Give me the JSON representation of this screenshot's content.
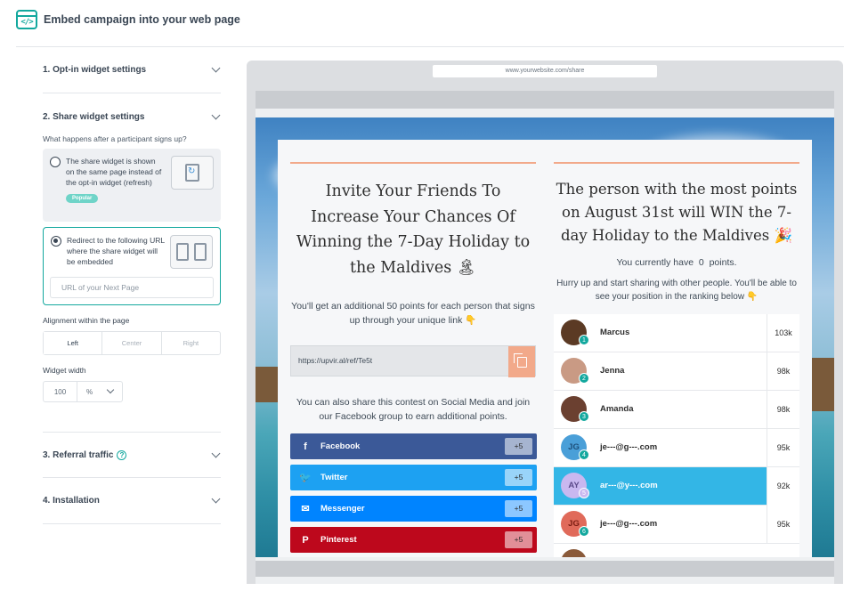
{
  "header": {
    "title": "Embed campaign into your web page",
    "icon": "embed-code-icon"
  },
  "left_panel": {
    "sections": [
      {
        "label": "1. Opt-in widget settings"
      },
      {
        "label": "2. Share widget settings"
      },
      {
        "label": "3. Referral traffic"
      },
      {
        "label": "4. Installation"
      }
    ],
    "question": "What happens after a participant signs up?",
    "option1": {
      "text": "The share widget is shown on the same page instead of the opt-in widget (refresh)",
      "badge": "Popular"
    },
    "option2": {
      "text": "Redirect to the following URL where the share widget will be embedded",
      "url_placeholder": "URL of your Next Page"
    },
    "alignment": {
      "label": "Alignment within the page",
      "options": [
        "Left",
        "Center",
        "Right"
      ],
      "selected": "Left"
    },
    "width": {
      "label": "Widget width",
      "value": "100",
      "unit": "%"
    }
  },
  "preview": {
    "address": "www.yourwebsite.com/share",
    "left": {
      "title": "Invite Your Friends To Increase Your Chances Of Winning the 7-Day Holiday to the Maldives 🏝",
      "desc": "You'll get an additional 50 points for each person that signs up through your unique link 👇",
      "link": "https://upvir.al/ref/Te5t",
      "social_desc": "You can also share this contest on Social Media and join our Facebook group to earn additional points.",
      "buttons": [
        {
          "label": "Facebook",
          "points": "+5",
          "color": "#3b5998",
          "icon": "f"
        },
        {
          "label": "Twitter",
          "points": "+5",
          "color": "#1da1f2",
          "icon": "🐦"
        },
        {
          "label": "Messenger",
          "points": "+5",
          "color": "#0084ff",
          "icon": "✉"
        },
        {
          "label": "Pinterest",
          "points": "+5",
          "color": "#bd081c",
          "icon": "P"
        }
      ]
    },
    "right": {
      "title": "The person with the most points on August 31st will WIN the 7-day Holiday to the Maldives 🎉",
      "points_pre": "You currently have",
      "points_val": "0",
      "points_post": "points.",
      "desc": "Hurry up and start sharing with other people. You'll be able to see your position in the ranking below 👇",
      "ranking": [
        {
          "pos": "1",
          "name": "Marcus",
          "score": "103k",
          "avatar": "photo",
          "color": "#5b3a24"
        },
        {
          "pos": "2",
          "name": "Jenna",
          "score": "98k",
          "avatar": "photo",
          "color": "#c99a84"
        },
        {
          "pos": "3",
          "name": "Amanda",
          "score": "98k",
          "avatar": "photo",
          "color": "#6b4030"
        },
        {
          "pos": "4",
          "name": "je---@g---.com",
          "score": "95k",
          "avatar": "JG",
          "color": "#4a9fd8"
        },
        {
          "pos": "5",
          "name": "ar---@y---.com",
          "score": "92k",
          "avatar": "AY",
          "color": "#c9b8f0"
        },
        {
          "pos": "6",
          "name": "je---@g---.com",
          "score": "95k",
          "avatar": "JG",
          "color": "#e06a5a"
        }
      ]
    }
  }
}
